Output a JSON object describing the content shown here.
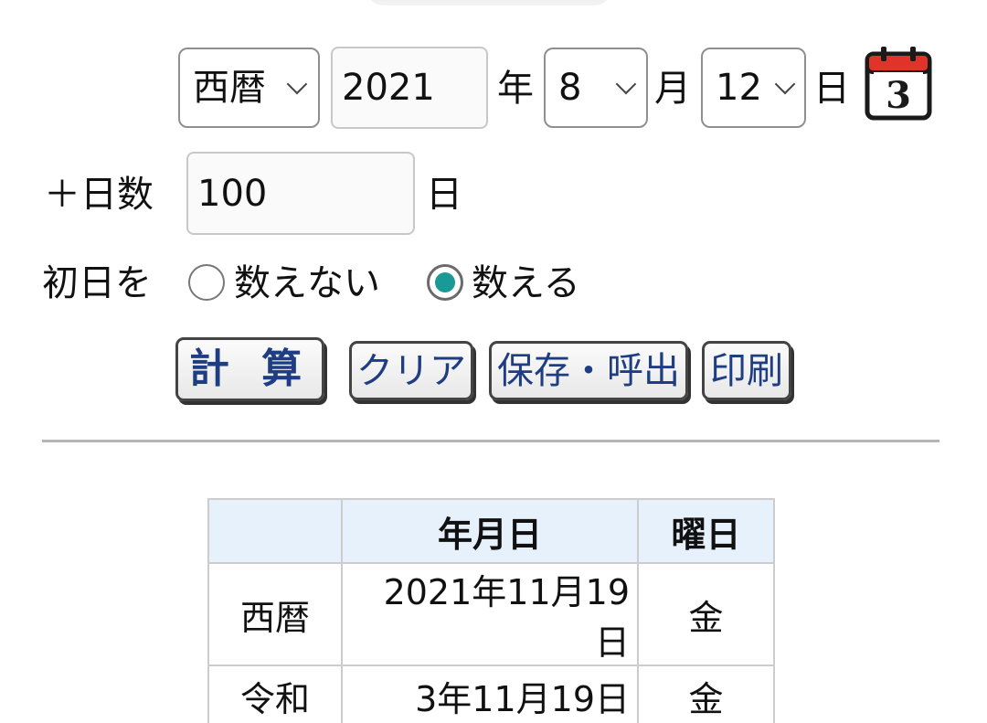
{
  "form": {
    "era_select": {
      "value": "西暦"
    },
    "year_input": {
      "value": "2021"
    },
    "year_label": "年",
    "month_select": {
      "value": "8"
    },
    "month_label": "月",
    "day_select": {
      "value": "12"
    },
    "day_label": "日",
    "calendar_icon_digit": "3",
    "add_days_label": "＋日数",
    "add_days_input": {
      "value": "100"
    },
    "add_days_unit": "日",
    "first_day_label": "初日を",
    "first_day_options": [
      {
        "label": "数えない",
        "checked": false
      },
      {
        "label": "数える",
        "checked": true
      }
    ]
  },
  "buttons": {
    "calculate": "計 算",
    "clear": "クリア",
    "save_load": "保存・呼出",
    "print": "印刷"
  },
  "result_table": {
    "headers": [
      "",
      "年月日",
      "曜日"
    ],
    "rows": [
      {
        "era": "西暦",
        "date": "2021年11月19日",
        "weekday": "金"
      },
      {
        "era": "令和",
        "date": "3年11月19日",
        "weekday": "金"
      }
    ]
  },
  "colors": {
    "radio_checked": "#1a9a96",
    "button_text": "#1f3d82",
    "table_header_bg": "#e6f1fc",
    "calendar_icon_red": "#e0342b"
  }
}
